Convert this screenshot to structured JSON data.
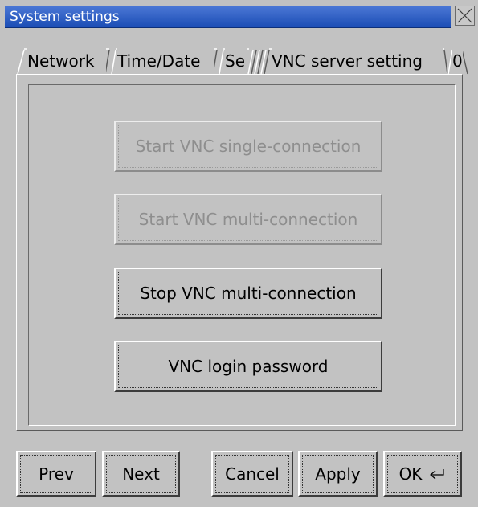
{
  "window": {
    "title": "System settings",
    "close_icon": "close-icon"
  },
  "tabs": [
    {
      "label": "Network"
    },
    {
      "label": "Time/Date"
    },
    {
      "label": "Se"
    },
    {
      "label": "VNC server setting",
      "active": true
    },
    {
      "label": "0"
    }
  ],
  "vnc": {
    "start_single": "Start VNC single-connection",
    "start_multi": "Start VNC multi-connection",
    "stop_multi": "Stop VNC multi-connection",
    "login_password": "VNC login password"
  },
  "footer": {
    "prev": "Prev",
    "next": "Next",
    "cancel": "Cancel",
    "apply": "Apply",
    "ok": "OK",
    "ok_icon": "enter-return-icon"
  },
  "colors": {
    "titlebar": "#1b4db5",
    "background": "#c2c2c2",
    "disabled_text": "#8e8e8e"
  }
}
